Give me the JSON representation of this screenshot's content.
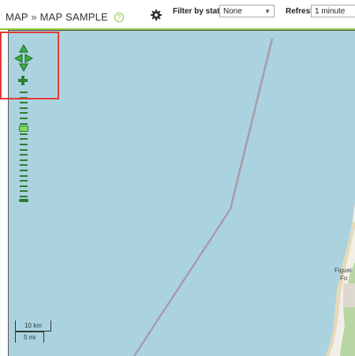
{
  "header": {
    "breadcrumb_root": "MAP",
    "breadcrumb_sep": "»",
    "breadcrumb_page": "MAP SAMPLE",
    "help_glyph": "?",
    "settings_icon": "gear-icon",
    "filter_label": "Filter by status:",
    "filter_value": "None",
    "refresh_label": "Refresh:",
    "refresh_value": "1 minute"
  },
  "map": {
    "controls": {
      "pan_icons": [
        "pan-up-icon",
        "pan-left-icon",
        "pan-right-icon",
        "pan-down-icon"
      ],
      "zoom_in_icon": "zoom-in-icon",
      "zoom_out_icon": "zoom-out-icon",
      "zoom_levels": 21,
      "zoom_level_selected": 7
    },
    "scale": {
      "metric": "10 km",
      "imperial": "5 mi"
    },
    "places": [
      "Figuei",
      "Fo"
    ],
    "colors": {
      "water": "#aad3df",
      "land": "#f2efe9",
      "boundary": "#a89ba8",
      "accent": "#8fc53f",
      "control": "#2e7d32"
    }
  }
}
